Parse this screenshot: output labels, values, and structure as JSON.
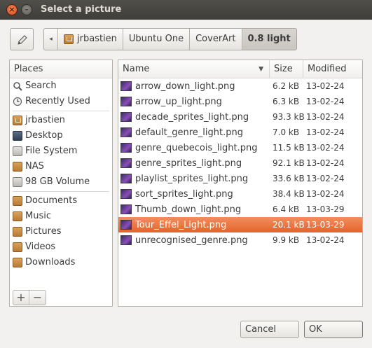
{
  "window": {
    "title": "Select a picture",
    "close_glyph": "×",
    "minimize_glyph": "–"
  },
  "breadcrumb": {
    "back_glyph": "◂",
    "items": [
      "jrbastien",
      "Ubuntu One",
      "CoverArt",
      "0.8 light"
    ]
  },
  "places": {
    "header": "Places",
    "items": [
      {
        "label": "Search",
        "icon": "search-icon"
      },
      {
        "label": "Recently Used",
        "icon": "clock-icon"
      },
      {
        "label": "jrbastien",
        "icon": "home-folder-icon"
      },
      {
        "label": "Desktop",
        "icon": "desktop-icon"
      },
      {
        "label": "File System",
        "icon": "drive-icon"
      },
      {
        "label": "NAS",
        "icon": "folder-icon"
      },
      {
        "label": "98 GB Volume",
        "icon": "drive-icon"
      },
      {
        "label": "Documents",
        "icon": "folder-icon"
      },
      {
        "label": "Music",
        "icon": "folder-icon"
      },
      {
        "label": "Pictures",
        "icon": "folder-icon"
      },
      {
        "label": "Videos",
        "icon": "folder-icon"
      },
      {
        "label": "Downloads",
        "icon": "folder-icon"
      }
    ],
    "add_label": "+",
    "remove_label": "−"
  },
  "files": {
    "columns": {
      "name": "Name",
      "size": "Size",
      "modified": "Modified"
    },
    "sort_glyph": "▼",
    "rows": [
      {
        "name": "arrow_down_light.png",
        "size": "6.2 kB",
        "modified": "13-02-24"
      },
      {
        "name": "arrow_up_light.png",
        "size": "6.3 kB",
        "modified": "13-02-24"
      },
      {
        "name": "decade_sprites_light.png",
        "size": "93.3 kB",
        "modified": "13-02-24"
      },
      {
        "name": "default_genre_light.png",
        "size": "7.0 kB",
        "modified": "13-02-24"
      },
      {
        "name": "genre_quebecois_light.png",
        "size": "11.5 kB",
        "modified": "13-02-24"
      },
      {
        "name": "genre_sprites_light.png",
        "size": "92.1 kB",
        "modified": "13-02-24"
      },
      {
        "name": "playlist_sprites_light.png",
        "size": "33.6 kB",
        "modified": "13-02-24"
      },
      {
        "name": "sort_sprites_light.png",
        "size": "38.4 kB",
        "modified": "13-02-24"
      },
      {
        "name": "Thumb_down_light.png",
        "size": "6.4 kB",
        "modified": "13-03-29"
      },
      {
        "name": "Tour_Effel_Light.png",
        "size": "20.1 kB",
        "modified": "13-03-29",
        "selected": true
      },
      {
        "name": "unrecognised_genre.png",
        "size": "9.9 kB",
        "modified": "13-02-24"
      }
    ]
  },
  "buttons": {
    "cancel": "Cancel",
    "ok": "OK"
  },
  "colors": {
    "selection": "#e76a32",
    "titlebar": "#3f3e3a"
  }
}
